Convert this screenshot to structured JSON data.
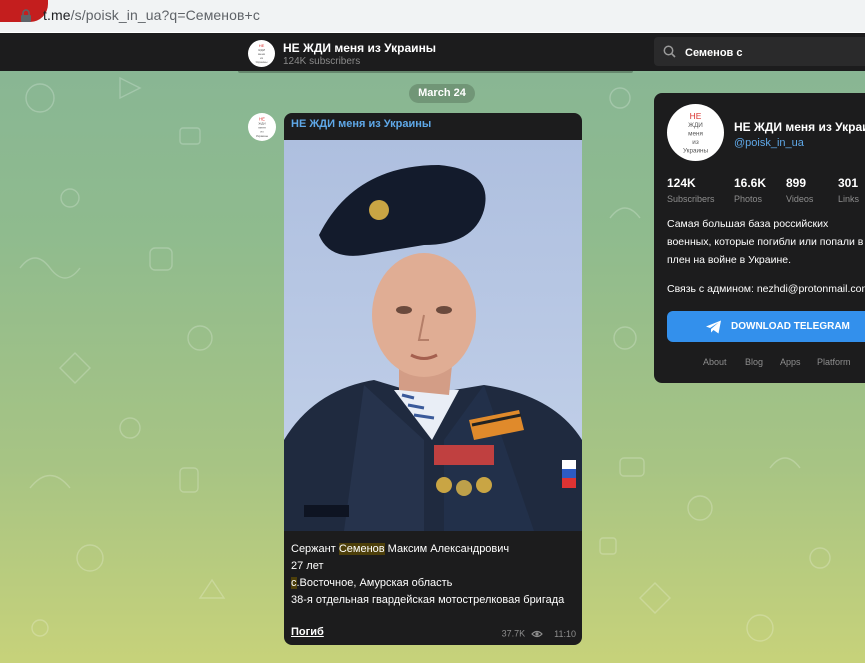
{
  "browser": {
    "url_host": "t.me",
    "url_path": "/s/poisk_in_ua?q=Семенов+с"
  },
  "header": {
    "avatar_text": [
      "НЕ",
      "ЖДИ",
      "меня",
      "из",
      "Украины"
    ],
    "title": "НЕ ЖДИ меня из Украины",
    "subscribers": "124K subscribers",
    "search_value": "Семенов с"
  },
  "date_chip": "March 24",
  "post": {
    "channel_name": "НЕ ЖДИ меня из Украины",
    "caption": {
      "line1_before": "Сержант ",
      "line1_highlight": "Семенов",
      "line1_after": " Максим Александрович",
      "line2": "27 лет",
      "line3_highlight": "с",
      "line3_after": ".Восточное, Амурская область",
      "line4": "38-я отдельная гвардейская мотострелковая бригада"
    },
    "status_link": "Погиб",
    "views": "37.7K",
    "time": "11:10"
  },
  "card": {
    "title": "НЕ ЖДИ меня из Украины",
    "handle": "@poisk_in_ua",
    "stats": [
      {
        "value": "124K",
        "label": "Subscribers"
      },
      {
        "value": "16.6K",
        "label": "Photos"
      },
      {
        "value": "899",
        "label": "Videos"
      },
      {
        "value": "301",
        "label": "Links"
      }
    ],
    "description_lines": [
      "Самая большая база российских",
      "военных, которые погибли или попали в",
      "плен на войне в Украине."
    ],
    "contact": "Связь с админом: nezhdi@protonmail.com",
    "download_label": "DOWNLOAD TELEGRAM",
    "footer_links": [
      "About",
      "Blog",
      "Apps",
      "Platform"
    ]
  },
  "colors": {
    "accent_link": "#5fa8e8",
    "button_blue": "#3390ec",
    "panel_dark": "#1c1c1d",
    "logo_red": "#d9322e"
  }
}
